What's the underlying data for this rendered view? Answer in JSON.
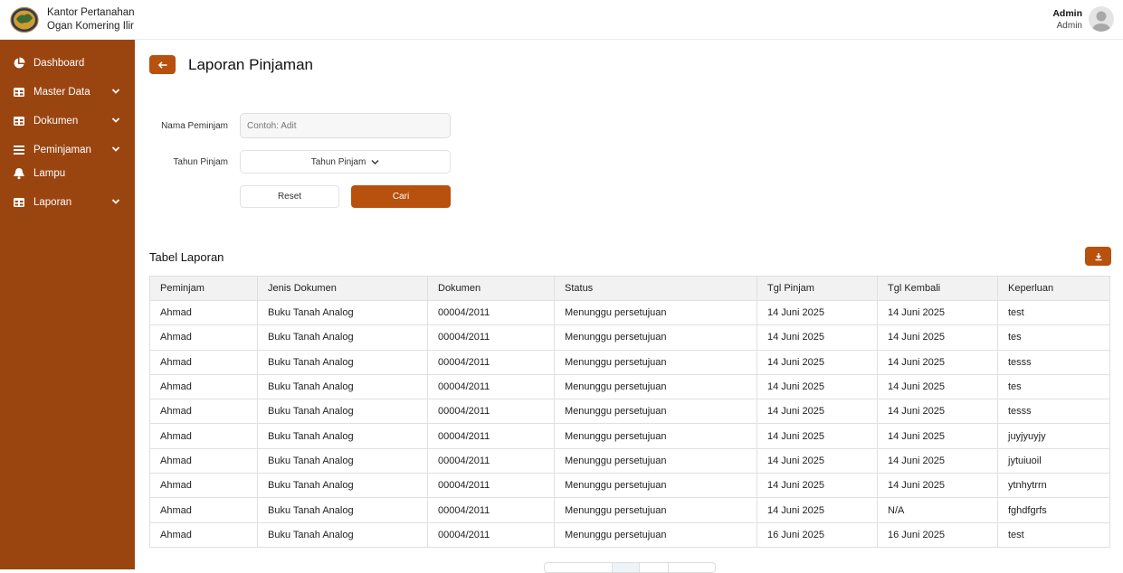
{
  "app": {
    "brand_line1": "Kantor Pertanahan",
    "brand_line2": "Ogan Komering Ilir",
    "accent": "#b8500e",
    "sidebar_color": "#9a4510"
  },
  "user": {
    "name": "Admin",
    "role": "Admin"
  },
  "sidebar": {
    "items": [
      {
        "label": "Dashboard",
        "icon": "pie-chart-icon",
        "has_chevron": false
      },
      {
        "label": "Master Data",
        "icon": "table-icon",
        "has_chevron": true
      },
      {
        "label": "Dokumen",
        "icon": "table-icon",
        "has_chevron": true
      },
      {
        "label": "Peminjaman",
        "icon": "list-icon",
        "has_chevron": true
      },
      {
        "label": "Lampu",
        "icon": "bell-icon",
        "has_chevron": false
      },
      {
        "label": "Laporan",
        "icon": "table-icon",
        "has_chevron": true
      }
    ]
  },
  "page": {
    "title": "Laporan Pinjaman",
    "back_icon": "arrow-left-icon"
  },
  "filters": {
    "name_label": "Nama Peminjam",
    "name_placeholder": "Contoh: Adit",
    "name_value": "",
    "year_label": "Tahun Pinjam",
    "year_selected": "Tahun Pinjam",
    "reset_label": "Reset",
    "search_label": "Cari"
  },
  "report": {
    "title": "Tabel Laporan",
    "download_icon": "download-icon",
    "columns": [
      "Peminjam",
      "Jenis Dokumen",
      "Dokumen",
      "Status",
      "Tgl Pinjam",
      "Tgl Kembali",
      "Keperluan"
    ],
    "rows": [
      [
        "Ahmad",
        "Buku Tanah Analog",
        "00004/2011",
        "Menunggu persetujuan",
        "14 Juni 2025",
        "14 Juni 2025",
        "test"
      ],
      [
        "Ahmad",
        "Buku Tanah Analog",
        "00004/2011",
        "Menunggu persetujuan",
        "14 Juni 2025",
        "14 Juni 2025",
        "tes"
      ],
      [
        "Ahmad",
        "Buku Tanah Analog",
        "00004/2011",
        "Menunggu persetujuan",
        "14 Juni 2025",
        "14 Juni 2025",
        "tesss"
      ],
      [
        "Ahmad",
        "Buku Tanah Analog",
        "00004/2011",
        "Menunggu persetujuan",
        "14 Juni 2025",
        "14 Juni 2025",
        "tes"
      ],
      [
        "Ahmad",
        "Buku Tanah Analog",
        "00004/2011",
        "Menunggu persetujuan",
        "14 Juni 2025",
        "14 Juni 2025",
        "tesss"
      ],
      [
        "Ahmad",
        "Buku Tanah Analog",
        "00004/2011",
        "Menunggu persetujuan",
        "14 Juni 2025",
        "14 Juni 2025",
        "juyjyuyjy"
      ],
      [
        "Ahmad",
        "Buku Tanah Analog",
        "00004/2011",
        "Menunggu persetujuan",
        "14 Juni 2025",
        "14 Juni 2025",
        "jytuiuoil"
      ],
      [
        "Ahmad",
        "Buku Tanah Analog",
        "00004/2011",
        "Menunggu persetujuan",
        "14 Juni 2025",
        "14 Juni 2025",
        "ytnhytrrn"
      ],
      [
        "Ahmad",
        "Buku Tanah Analog",
        "00004/2011",
        "Menunggu persetujuan",
        "14 Juni 2025",
        "N/A",
        "fghdfgrfs"
      ],
      [
        "Ahmad",
        "Buku Tanah Analog",
        "00004/2011",
        "Menunggu persetujuan",
        "16 Juni 2025",
        "16 Juni 2025",
        "test"
      ]
    ]
  }
}
